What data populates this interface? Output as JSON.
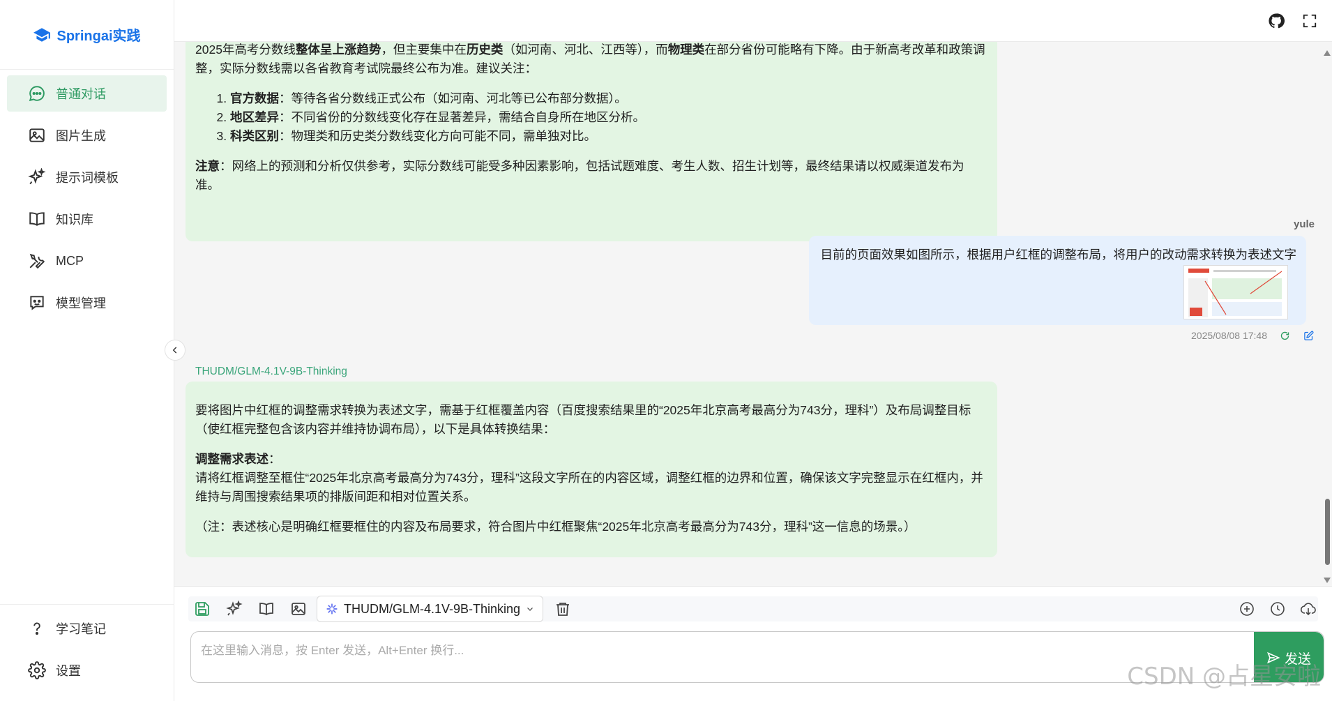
{
  "brand": {
    "name": "Springai实践",
    "icon": "graduation-cap-icon"
  },
  "sidebar": {
    "items": [
      {
        "label": "普通对话",
        "icon": "chat-bubble-icon",
        "active": true
      },
      {
        "label": "图片生成",
        "icon": "image-icon"
      },
      {
        "label": "提示词模板",
        "icon": "sparkles-icon"
      },
      {
        "label": "知识库",
        "icon": "book-icon"
      },
      {
        "label": "MCP",
        "icon": "tools-icon"
      },
      {
        "label": "模型管理",
        "icon": "robot-face-icon"
      }
    ],
    "bottom": [
      {
        "label": "学习笔记",
        "icon": "question-icon"
      },
      {
        "label": "设置",
        "icon": "gear-icon"
      }
    ]
  },
  "topbar": {
    "icons": [
      "github-icon",
      "fullscreen-icon"
    ]
  },
  "messages": {
    "ai1": {
      "p1_part1": "2025年高考分数线",
      "p1_bold1": "整体呈上涨趋势",
      "p1_part2": "，但主要集中在",
      "p1_bold2": "历史类",
      "p1_part3": "（如河南、河北、江西等），而",
      "p1_bold3": "物理类",
      "p1_part4": "在部分省份可能略有下降。由于新高考改革和政策调整，实际分数线需以各省教育考试院最终公布为准。建议关注：",
      "list": [
        {
          "bold": "官方数据",
          "text": "：等待各省分数线正式公布（如河南、河北等已公布部分数据）。"
        },
        {
          "bold": "地区差异",
          "text": "：不同省份的分数线变化存在显著差异，需结合自身所在地区分析。"
        },
        {
          "bold": "科类区别",
          "text": "：物理类和历史类分数线变化方向可能不同，需单独对比。"
        }
      ],
      "note_bold": "注意",
      "note_text": "：网络上的预测和分析仅供参考，实际分数线可能受多种因素影响，包括试题难度、考生人数、招生计划等，最终结果请以权威渠道发布为准。"
    },
    "user": {
      "name": "yule",
      "text": "目前的页面效果如图所示，根据用户红框的调整布局，将用户的改动需求转换为表述文字",
      "time": "2025/08/08 17:48"
    },
    "ai2": {
      "model": "THUDM/GLM-4.1V-9B-Thinking",
      "p1": "要将图片中红框的调整需求转换为表述文字，需基于红框覆盖内容（百度搜索结果里的“2025年北京高考最高分为743分，理科”）及布局调整目标（使红框完整包含该内容并维持协调布局），以下是具体转换结果：",
      "heading": "调整需求表述",
      "heading_colon": "：",
      "p2": "请将红框调整至框住“2025年北京高考最高分为743分，理科”这段文字所在的内容区域，调整红框的边界和位置，确保该文字完整显示在红框内，并维持与周围搜索结果项的排版间距和相对位置关系。",
      "p3": "（注：表述核心是明确红框要框住的内容及布局要求，符合图片中红框聚焦“2025年北京高考最高分为743分，理科”这一信息的场景。）"
    }
  },
  "composer": {
    "model_select": "THUDM/GLM-4.1V-9B-Thinking",
    "placeholder": "在这里输入消息，按 Enter 发送，Alt+Enter 换行...",
    "value": "",
    "send_label": "发送"
  },
  "watermark": "CSDN @占星安啦",
  "colors": {
    "accent": "#2e9d5f",
    "ai_bubble": "#e3f5e3",
    "user_bubble": "#e6f0fd",
    "brand": "#1a73e8"
  }
}
